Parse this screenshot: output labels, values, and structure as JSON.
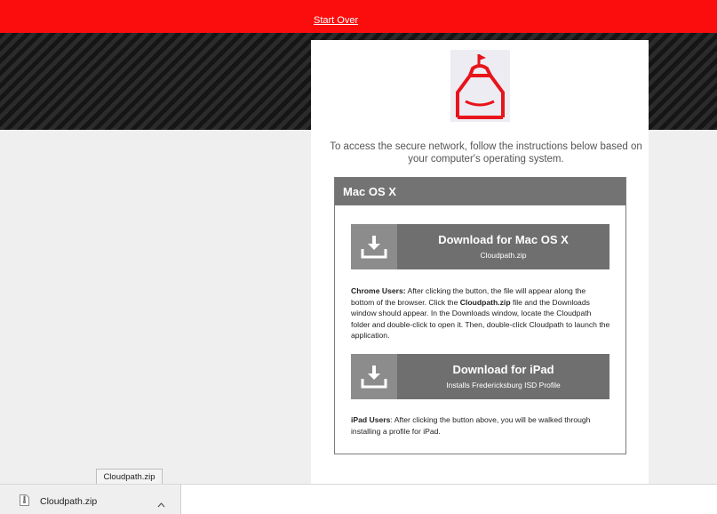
{
  "topbar": {
    "start_over": "Start Over"
  },
  "intro_text": "To access the secure network, follow the instructions below based on your computer's operating system.",
  "panel": {
    "title": "Mac OS X",
    "mac_button": {
      "title": "Download for Mac OS X",
      "subtitle": "Cloudpath.zip"
    },
    "chrome_note": {
      "label": "Chrome Users:",
      "text1": " After clicking the button, the file will appear along the bottom of the browser. Click the ",
      "bold_file": "Cloudpath.zip",
      "text2": " file and the Downloads window should appear. In the Downloads window, locate the Cloudpath folder and double-click to open it. Then, double-click Cloudpath to launch the application."
    },
    "ipad_button": {
      "title": "Download for iPad",
      "subtitle": "Installs Fredericksburg ISD Profile"
    },
    "ipad_note": {
      "label": "iPad Users",
      "text": ": After clicking the button above, you will be walked through installing a profile for iPad."
    }
  },
  "download_shelf": {
    "tooltip": "Cloudpath.zip",
    "file_name": "Cloudpath.zip"
  },
  "colors": {
    "brand_red": "#fb0d0d",
    "panel_gray": "#737373",
    "button_gray": "#6f6f6f"
  },
  "icons": [
    "download-icon",
    "school-logo",
    "zip-file-icon",
    "chevron-up-icon"
  ]
}
